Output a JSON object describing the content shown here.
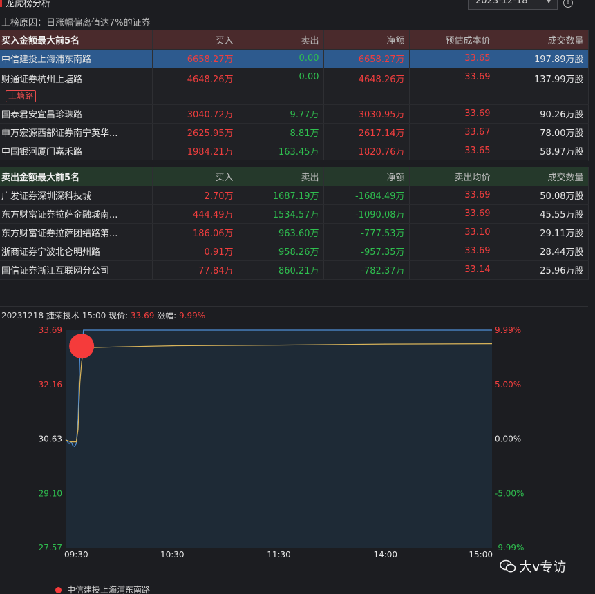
{
  "header": {
    "title": "龙虎榜分析",
    "date": "2023-12-18",
    "reason": "上榜原因：日涨幅偏离值达7%的证券"
  },
  "buy_table": {
    "columns": [
      "买入金额最大前5名",
      "买入",
      "卖出",
      "净额",
      "预估成本价",
      "成交数量"
    ],
    "rows": [
      {
        "name": "中信建投上海浦东南路",
        "buy": "6658.27万",
        "sell": "0.00",
        "net": "6658.27万",
        "price": "33.65",
        "volume": "197.89万股",
        "selected": true,
        "tag": ""
      },
      {
        "name": "财通证券杭州上塘路",
        "buy": "4648.26万",
        "sell": "0.00",
        "net": "4648.26万",
        "price": "33.69",
        "volume": "137.99万股",
        "selected": false,
        "tag": "上塘路"
      },
      {
        "name": "国泰君安宜昌珍珠路",
        "buy": "3040.72万",
        "sell": "9.77万",
        "net": "3030.95万",
        "price": "33.69",
        "volume": "90.26万股",
        "selected": false,
        "tag": ""
      },
      {
        "name": "申万宏源西部证券南宁英华...",
        "buy": "2625.95万",
        "sell": "8.81万",
        "net": "2617.14万",
        "price": "33.67",
        "volume": "78.00万股",
        "selected": false,
        "tag": ""
      },
      {
        "name": "中国银河厦门嘉禾路",
        "buy": "1984.21万",
        "sell": "163.45万",
        "net": "1820.76万",
        "price": "33.65",
        "volume": "58.97万股",
        "selected": false,
        "tag": ""
      }
    ]
  },
  "sell_table": {
    "columns": [
      "卖出金额最大前5名",
      "买入",
      "卖出",
      "净额",
      "卖出均价",
      "成交数量"
    ],
    "rows": [
      {
        "name": "广发证券深圳深科技城",
        "buy": "2.70万",
        "sell": "1687.19万",
        "net": "-1684.49万",
        "price": "33.69",
        "volume": "50.08万股"
      },
      {
        "name": "东方财富证券拉萨金融城南...",
        "buy": "444.49万",
        "sell": "1534.57万",
        "net": "-1090.08万",
        "price": "33.69",
        "volume": "45.55万股"
      },
      {
        "name": "东方财富证券拉萨团结路第...",
        "buy": "186.06万",
        "sell": "963.60万",
        "net": "-777.53万",
        "price": "33.10",
        "volume": "29.11万股"
      },
      {
        "name": "浙商证券宁波北仑明州路",
        "buy": "0.91万",
        "sell": "958.26万",
        "net": "-957.35万",
        "price": "33.69",
        "volume": "28.44万股"
      },
      {
        "name": "国信证券浙江互联网分公司",
        "buy": "77.84万",
        "sell": "860.21万",
        "net": "-782.37万",
        "price": "33.14",
        "volume": "25.96万股"
      }
    ]
  },
  "chart_header": {
    "prefix": "20231218 捷荣技术 15:00 现价:",
    "price": "33.69",
    "change_label": "涨幅:",
    "change": "9.99%"
  },
  "chart_data": {
    "type": "line",
    "x_ticks": [
      "09:30",
      "10:30",
      "11:30",
      "14:00",
      "15:00"
    ],
    "y_left_ticks": [
      "33.69",
      "32.16",
      "30.63",
      "29.10",
      "27.57"
    ],
    "y_right_ticks": [
      "9.99%",
      "5.00%",
      "0.00%",
      "-5.00%",
      "-9.99%"
    ],
    "ylim": [
      27.57,
      33.69
    ],
    "series": [
      {
        "color": "#4f8fd6",
        "points": [
          [
            0,
            30.63
          ],
          [
            1,
            30.55
          ],
          [
            2,
            30.5
          ],
          [
            3,
            30.56
          ],
          [
            4,
            30.45
          ],
          [
            5,
            30.42
          ],
          [
            6,
            30.5
          ],
          [
            7,
            31.2
          ],
          [
            8,
            33.0
          ],
          [
            9,
            32.9
          ],
          [
            10,
            33.69
          ],
          [
            20,
            33.69
          ],
          [
            60,
            33.69
          ],
          [
            120,
            33.69
          ],
          [
            240,
            33.69
          ]
        ]
      },
      {
        "color": "#d9b45a",
        "points": [
          [
            0,
            30.6
          ],
          [
            3,
            30.55
          ],
          [
            6,
            30.55
          ],
          [
            7,
            30.9
          ],
          [
            8,
            32.2
          ],
          [
            9,
            32.8
          ],
          [
            10,
            33.1
          ],
          [
            15,
            33.2
          ],
          [
            30,
            33.22
          ],
          [
            60,
            33.25
          ],
          [
            120,
            33.27
          ],
          [
            180,
            33.3
          ],
          [
            240,
            33.31
          ]
        ]
      }
    ],
    "marker": {
      "label": "中信建投上海浦东南路",
      "x": 9,
      "y": 33.24,
      "color": "#f53b3b"
    }
  },
  "watermark": "大v专访"
}
